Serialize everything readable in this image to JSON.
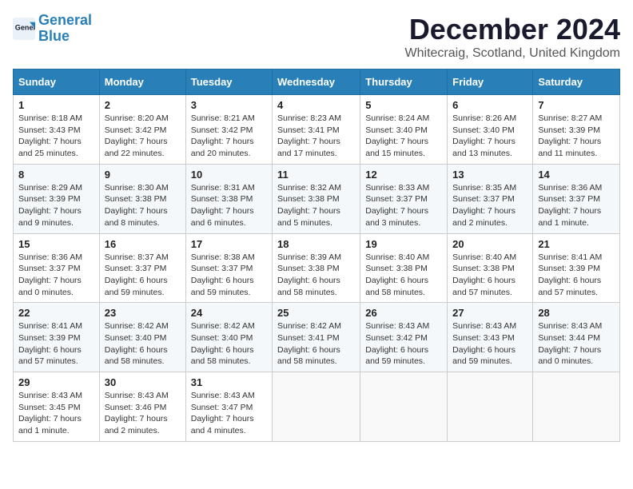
{
  "logo": {
    "line1": "General",
    "line2": "Blue"
  },
  "title": "December 2024",
  "location": "Whitecraig, Scotland, United Kingdom",
  "days_of_week": [
    "Sunday",
    "Monday",
    "Tuesday",
    "Wednesday",
    "Thursday",
    "Friday",
    "Saturday"
  ],
  "weeks": [
    [
      {
        "day": "1",
        "info": "Sunrise: 8:18 AM\nSunset: 3:43 PM\nDaylight: 7 hours and 25 minutes."
      },
      {
        "day": "2",
        "info": "Sunrise: 8:20 AM\nSunset: 3:42 PM\nDaylight: 7 hours and 22 minutes."
      },
      {
        "day": "3",
        "info": "Sunrise: 8:21 AM\nSunset: 3:42 PM\nDaylight: 7 hours and 20 minutes."
      },
      {
        "day": "4",
        "info": "Sunrise: 8:23 AM\nSunset: 3:41 PM\nDaylight: 7 hours and 17 minutes."
      },
      {
        "day": "5",
        "info": "Sunrise: 8:24 AM\nSunset: 3:40 PM\nDaylight: 7 hours and 15 minutes."
      },
      {
        "day": "6",
        "info": "Sunrise: 8:26 AM\nSunset: 3:40 PM\nDaylight: 7 hours and 13 minutes."
      },
      {
        "day": "7",
        "info": "Sunrise: 8:27 AM\nSunset: 3:39 PM\nDaylight: 7 hours and 11 minutes."
      }
    ],
    [
      {
        "day": "8",
        "info": "Sunrise: 8:29 AM\nSunset: 3:39 PM\nDaylight: 7 hours and 9 minutes."
      },
      {
        "day": "9",
        "info": "Sunrise: 8:30 AM\nSunset: 3:38 PM\nDaylight: 7 hours and 8 minutes."
      },
      {
        "day": "10",
        "info": "Sunrise: 8:31 AM\nSunset: 3:38 PM\nDaylight: 7 hours and 6 minutes."
      },
      {
        "day": "11",
        "info": "Sunrise: 8:32 AM\nSunset: 3:38 PM\nDaylight: 7 hours and 5 minutes."
      },
      {
        "day": "12",
        "info": "Sunrise: 8:33 AM\nSunset: 3:37 PM\nDaylight: 7 hours and 3 minutes."
      },
      {
        "day": "13",
        "info": "Sunrise: 8:35 AM\nSunset: 3:37 PM\nDaylight: 7 hours and 2 minutes."
      },
      {
        "day": "14",
        "info": "Sunrise: 8:36 AM\nSunset: 3:37 PM\nDaylight: 7 hours and 1 minute."
      }
    ],
    [
      {
        "day": "15",
        "info": "Sunrise: 8:36 AM\nSunset: 3:37 PM\nDaylight: 7 hours and 0 minutes."
      },
      {
        "day": "16",
        "info": "Sunrise: 8:37 AM\nSunset: 3:37 PM\nDaylight: 6 hours and 59 minutes."
      },
      {
        "day": "17",
        "info": "Sunrise: 8:38 AM\nSunset: 3:37 PM\nDaylight: 6 hours and 59 minutes."
      },
      {
        "day": "18",
        "info": "Sunrise: 8:39 AM\nSunset: 3:38 PM\nDaylight: 6 hours and 58 minutes."
      },
      {
        "day": "19",
        "info": "Sunrise: 8:40 AM\nSunset: 3:38 PM\nDaylight: 6 hours and 58 minutes."
      },
      {
        "day": "20",
        "info": "Sunrise: 8:40 AM\nSunset: 3:38 PM\nDaylight: 6 hours and 57 minutes."
      },
      {
        "day": "21",
        "info": "Sunrise: 8:41 AM\nSunset: 3:39 PM\nDaylight: 6 hours and 57 minutes."
      }
    ],
    [
      {
        "day": "22",
        "info": "Sunrise: 8:41 AM\nSunset: 3:39 PM\nDaylight: 6 hours and 57 minutes."
      },
      {
        "day": "23",
        "info": "Sunrise: 8:42 AM\nSunset: 3:40 PM\nDaylight: 6 hours and 58 minutes."
      },
      {
        "day": "24",
        "info": "Sunrise: 8:42 AM\nSunset: 3:40 PM\nDaylight: 6 hours and 58 minutes."
      },
      {
        "day": "25",
        "info": "Sunrise: 8:42 AM\nSunset: 3:41 PM\nDaylight: 6 hours and 58 minutes."
      },
      {
        "day": "26",
        "info": "Sunrise: 8:43 AM\nSunset: 3:42 PM\nDaylight: 6 hours and 59 minutes."
      },
      {
        "day": "27",
        "info": "Sunrise: 8:43 AM\nSunset: 3:43 PM\nDaylight: 6 hours and 59 minutes."
      },
      {
        "day": "28",
        "info": "Sunrise: 8:43 AM\nSunset: 3:44 PM\nDaylight: 7 hours and 0 minutes."
      }
    ],
    [
      {
        "day": "29",
        "info": "Sunrise: 8:43 AM\nSunset: 3:45 PM\nDaylight: 7 hours and 1 minute."
      },
      {
        "day": "30",
        "info": "Sunrise: 8:43 AM\nSunset: 3:46 PM\nDaylight: 7 hours and 2 minutes."
      },
      {
        "day": "31",
        "info": "Sunrise: 8:43 AM\nSunset: 3:47 PM\nDaylight: 7 hours and 4 minutes."
      },
      null,
      null,
      null,
      null
    ]
  ]
}
